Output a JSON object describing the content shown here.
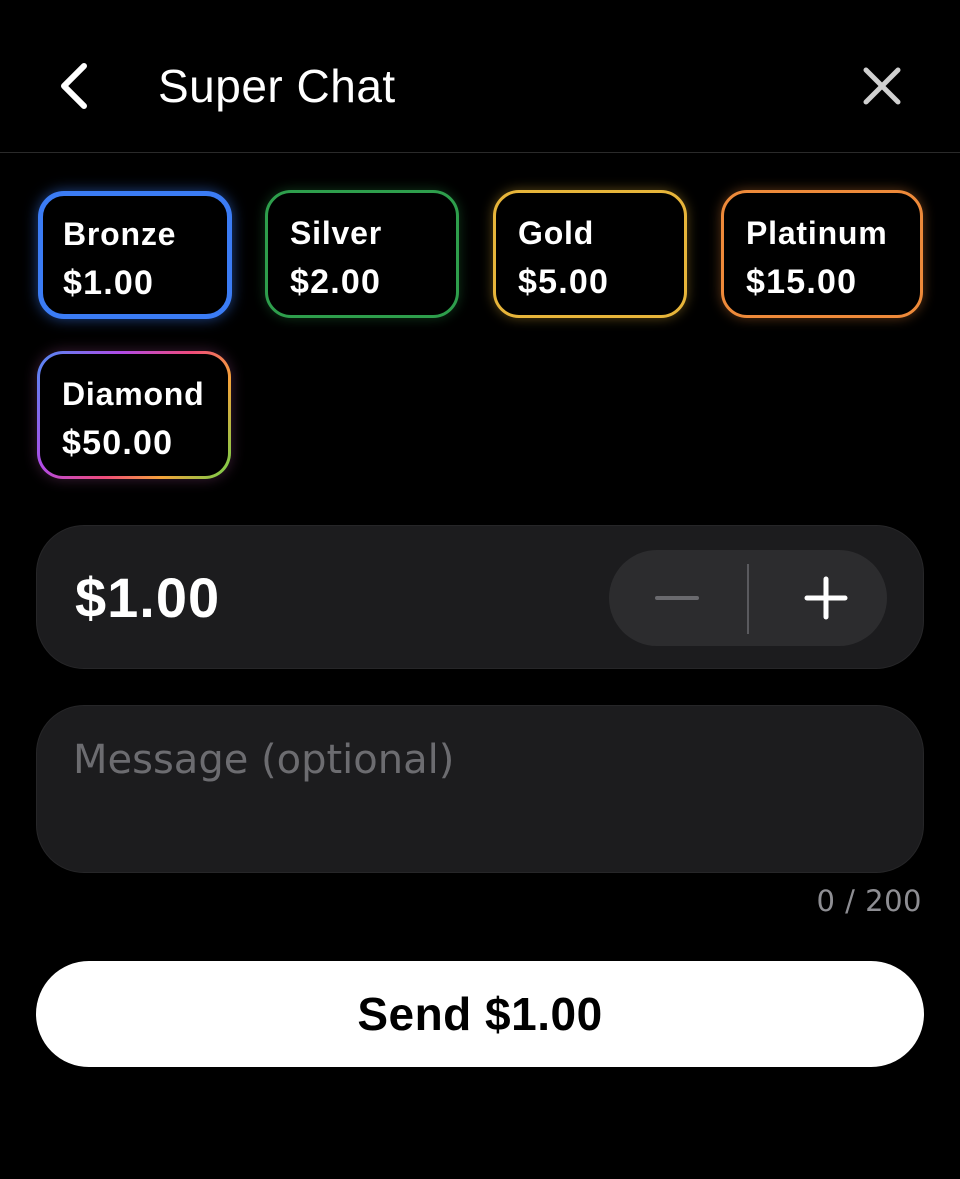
{
  "header": {
    "title": "Super Chat",
    "back_icon": "chevron-left-icon",
    "close_icon": "close-icon"
  },
  "tiers": [
    {
      "name": "Bronze",
      "price": "$1.00",
      "color": "#3b7cf5",
      "selected": true
    },
    {
      "name": "Silver",
      "price": "$2.00",
      "color": "#2e9e4c",
      "selected": false
    },
    {
      "name": "Gold",
      "price": "$5.00",
      "color": "#e7b53a",
      "selected": false
    },
    {
      "name": "Platinum",
      "price": "$15.00",
      "color": "#ee8a3a",
      "selected": false
    },
    {
      "name": "Diamond",
      "price": "$50.00",
      "color": "rainbow-gradient",
      "selected": false
    }
  ],
  "amount": {
    "value": "$1.00",
    "minus_icon": "minus-icon",
    "plus_icon": "plus-icon"
  },
  "message": {
    "placeholder": "Message (optional)",
    "value": "",
    "char_count": "0 / 200"
  },
  "send_button": {
    "label": "Send $1.00"
  },
  "colors": {
    "background": "#000000",
    "panel": "#1c1c1e",
    "stepper": "#2c2c2e",
    "send_button_bg": "#ffffff",
    "send_button_text": "#000000",
    "placeholder": "#6c6c70",
    "muted_text": "#8e8e93"
  }
}
